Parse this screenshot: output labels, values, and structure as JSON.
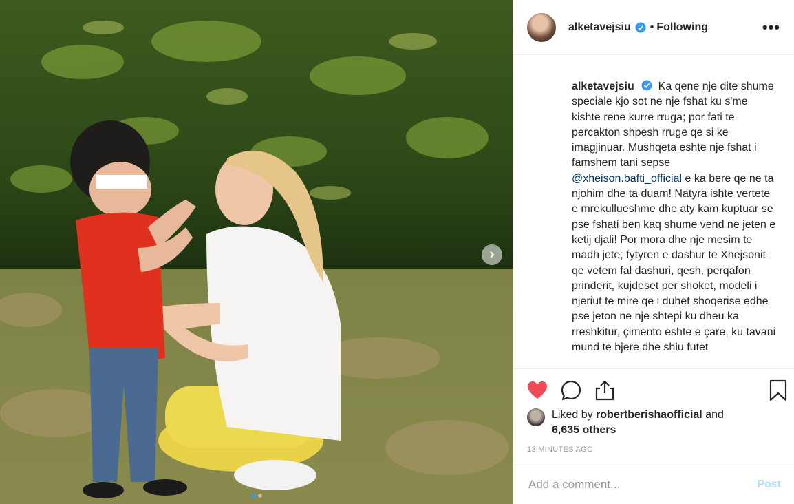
{
  "post": {
    "username": "alketavejsiu",
    "separator": "•",
    "follow_status": "Following",
    "more_label": "•••"
  },
  "caption": {
    "username": "alketavejsiu",
    "text_before_mention": "Ka qene nje dite shume speciale kjo sot ne nje fshat ku s'me kishte rene kurre rruga; por fati te percakton shpesh rruge qe si ke imagjinuar. Mushqeta eshte nje fshat i famshem tani sepse",
    "mention": "@xheison.bafti_official",
    "text_after_mention": "e ka bere qe ne ta njohim dhe ta duam! Natyra ishte vertete e mrekullueshme dhe aty kam kuptuar se pse fshati ben kaq shume vend ne jeten e ketij djali! Por mora dhe nje mesim te madh jete; fytyren e dashur te Xhejsonit qe vetem fal dashuri, qesh, perqafon prinderit, kujdeset per shoket, modeli i njeriut te mire qe i duhet shoqerise edhe pse jeton ne nje shtepi ku dheu ka rreshkitur, çimento eshte e çare, ku tavani mund te bjere dhe shiu futet"
  },
  "likes": {
    "prefix": "Liked by",
    "liker": "robertberishaofficial",
    "and": "and",
    "others": "6,635 others"
  },
  "timestamp": "13 MINUTES AGO",
  "comment_box": {
    "placeholder": "Add a comment...",
    "post_label": "Post"
  },
  "colors": {
    "verified": "#3897f0",
    "like_heart": "#ed4956",
    "mention": "#003569",
    "post_disabled": "#b2dffc"
  },
  "carousel": {
    "current_slide": 1,
    "total_slides": 2
  },
  "icons": [
    "verified-badge-icon",
    "more-options-icon",
    "heart-icon",
    "comment-icon",
    "share-icon",
    "bookmark-icon",
    "next-arrow-icon"
  ]
}
